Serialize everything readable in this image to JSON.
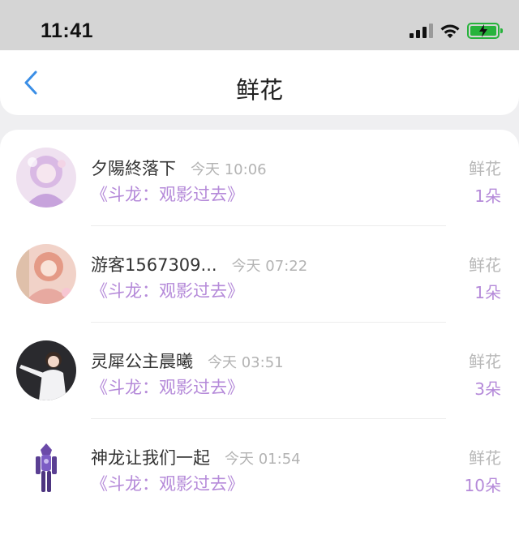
{
  "status_bar": {
    "time": "11:41"
  },
  "nav": {
    "title": "鲜花"
  },
  "items": [
    {
      "user": "夕陽終落下",
      "time": "今天 10:06",
      "book": "《斗龙：观影过去》",
      "gift": "鲜花",
      "count": "1朵"
    },
    {
      "user": "游客1567309...",
      "time": "今天 07:22",
      "book": "《斗龙：观影过去》",
      "gift": "鲜花",
      "count": "1朵"
    },
    {
      "user": "灵犀公主晨曦",
      "time": "今天 03:51",
      "book": "《斗龙：观影过去》",
      "gift": "鲜花",
      "count": "3朵"
    },
    {
      "user": "神龙让我们一起",
      "time": "今天 01:54",
      "book": "《斗龙：观影过去》",
      "gift": "鲜花",
      "count": "10朵"
    }
  ],
  "colors": {
    "accent": "#b58ad9",
    "back": "#3a8ee6",
    "battery": "#27b33c"
  }
}
